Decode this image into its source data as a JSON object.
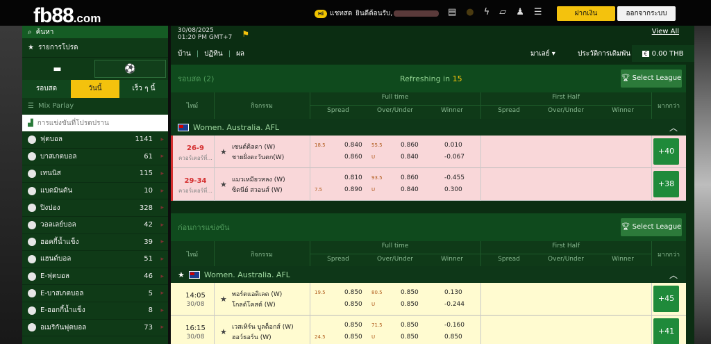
{
  "header": {
    "logo_main": "fb88",
    "logo_suffix": ".com",
    "livechat_badge": "Hi",
    "livechat_label": "แชทสด",
    "welcome": "ยินดีต้อนรับ,",
    "deposit_btn": "ฝากเงิน",
    "logout_btn": "ออกจากระบบ"
  },
  "sidebar": {
    "search": "ค้นหา",
    "favorites": "รายการโปรด",
    "period_tabs": [
      "รอบสด",
      "วันนี้",
      "เร็ว ๆ นี้"
    ],
    "mix_parlay": "Mix Parlay",
    "fav_games": "การแข่งขันที่โปรดปราน",
    "sports": [
      {
        "name": "ฟุตบอล",
        "count": "1141"
      },
      {
        "name": "บาสเกตบอล",
        "count": "61"
      },
      {
        "name": "เทนนิส",
        "count": "115"
      },
      {
        "name": "แบดมินตัน",
        "count": "10"
      },
      {
        "name": "ปิงปอง",
        "count": "328"
      },
      {
        "name": "วอลเลย์บอล",
        "count": "42"
      },
      {
        "name": "ฮอคกี้น้ำแข็ง",
        "count": "39"
      },
      {
        "name": "แฮนด์บอล",
        "count": "51"
      },
      {
        "name": "E-ฟุตบอล",
        "count": "46"
      },
      {
        "name": "E-บาสเกตบอล",
        "count": "5"
      },
      {
        "name": "E-ฮอกกี้น้ำแข็ง",
        "count": "8"
      },
      {
        "name": "อเมริกันฟุตบอล",
        "count": "73"
      }
    ]
  },
  "main": {
    "date": "30/08/2025",
    "time": "01:20 PM GMT+7",
    "view_all": "View All",
    "nav": [
      "บ้าน",
      "ปฏิทิน",
      "ผล"
    ],
    "market": "มาเลย์",
    "bet_history": "ประวัติการเดิมพัน",
    "balance": "0.00 THB",
    "live": {
      "title": "รอบสด (2)",
      "refresh_label": "Refreshing in",
      "refresh_val": "15",
      "select_league": "Select League"
    },
    "upcoming": {
      "title": "ก่อนการแข่งขัน",
      "select_league": "Select League"
    },
    "cols": {
      "time": "ไทม์",
      "event": "กิจกรรม",
      "full_time": "Full time",
      "first_half": "First Half",
      "more": "มากกว่า",
      "spread": "Spread",
      "ou": "Over/Under",
      "winner": "Winner"
    },
    "league": "Women. Australia. AFL",
    "live_rows": [
      {
        "score": "26-9",
        "state": "ควอร์เตอร์ที่...",
        "home": "เซนต์คิลดา (W)",
        "away": "ชายฝั่งตะวันตก(W)",
        "hdp": "18.5",
        "sp1": "0.840",
        "sp2": "0.860",
        "ouh": "55.5",
        "ouu": "U",
        "ou1": "0.860",
        "ou2": "0.840",
        "w1": "0.010",
        "w2": "-0.067",
        "more": "+40"
      },
      {
        "score": "29-34",
        "state": "ควอร์เตอร์ที่...",
        "home": "แมวเหมียวหลง (W)",
        "away": "ซิดนีย์ สวอนส์ (W)",
        "hdp": "7.5",
        "sp1": "0.810",
        "sp2": "0.890",
        "ouh": "93.5",
        "ouu": "U",
        "ou1": "0.860",
        "ou2": "0.840",
        "w1": "-0.455",
        "w2": "0.300",
        "more": "+38"
      }
    ],
    "pre_rows": [
      {
        "time": "14:05",
        "date": "30/08",
        "home": "พอร์ตแอดิเลด (W)",
        "away": "โกลด์โคสต์ (W)",
        "hdp": "19.5",
        "sp1": "0.850",
        "sp2": "0.850",
        "ouh": "80.5",
        "ouu": "U",
        "ou1": "0.850",
        "ou2": "0.850",
        "w1": "0.130",
        "w2": "-0.244",
        "more": "+45"
      },
      {
        "time": "16:15",
        "date": "30/08",
        "home": "เวสเทิร์น บูลด็อกส์ (W)",
        "away": "ฮอว์ธอร์น (W)",
        "hdp": "24.5",
        "sp1": "0.850",
        "sp2": "0.850",
        "ouh": "71.5",
        "ouu": "U",
        "ou1": "0.850",
        "ou2": "0.850",
        "w1": "-0.160",
        "w2": "0.850",
        "more": "+41"
      }
    ]
  }
}
